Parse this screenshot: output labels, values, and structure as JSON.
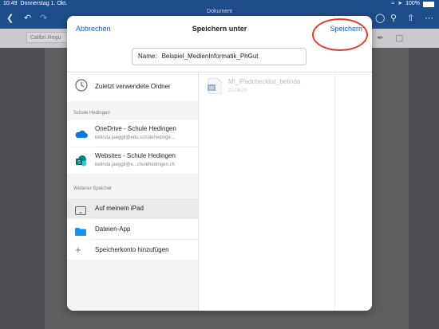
{
  "status_bar": {
    "time": "10:49",
    "date": "Donnerstag 1. Okt.",
    "battery": "100%"
  },
  "word": {
    "document_label": "Dokument",
    "font_name": "Calibri Regu"
  },
  "dialog": {
    "cancel_label": "Abbrechen",
    "title": "Speichern unter",
    "save_label": "Speichern",
    "name_label": "Name:",
    "name_value": "Beispiel_MedienInformatik_PhGut",
    "recent": "Zuletzt verwendete Ordner",
    "section_org": "Schule Hedingen",
    "onedrive": {
      "title": "OneDrive - Schule Hedingen",
      "subtitle": "belinda.jaeggli@edu.schulehedinge..."
    },
    "websites": {
      "title": "Websites - Schule Hedingen",
      "subtitle": "belinda.jaeggli@e...chulehedingen.ch"
    },
    "section_other": "Weiterer Speicher",
    "ipad": "Auf meinem iPad",
    "files_app": "Dateien-App",
    "add_account": "Speicherkonto hinzufügen",
    "file": {
      "name": "MI_iPadchecklist_belinda",
      "date": "21.09.20"
    }
  },
  "colors": {
    "accent": "#1a5ec4",
    "word_blue": "#1e4d8c",
    "highlight": "#e23c2b"
  },
  "icons": [
    "back-icon",
    "undo-icon",
    "redo-icon",
    "clock-icon",
    "onedrive-icon",
    "sharepoint-icon",
    "ipad-icon",
    "folder-icon",
    "plus-icon",
    "word-file-icon",
    "lightbulb-icon",
    "search-icon",
    "share-icon",
    "more-icon",
    "wifi-icon",
    "battery-icon"
  ]
}
